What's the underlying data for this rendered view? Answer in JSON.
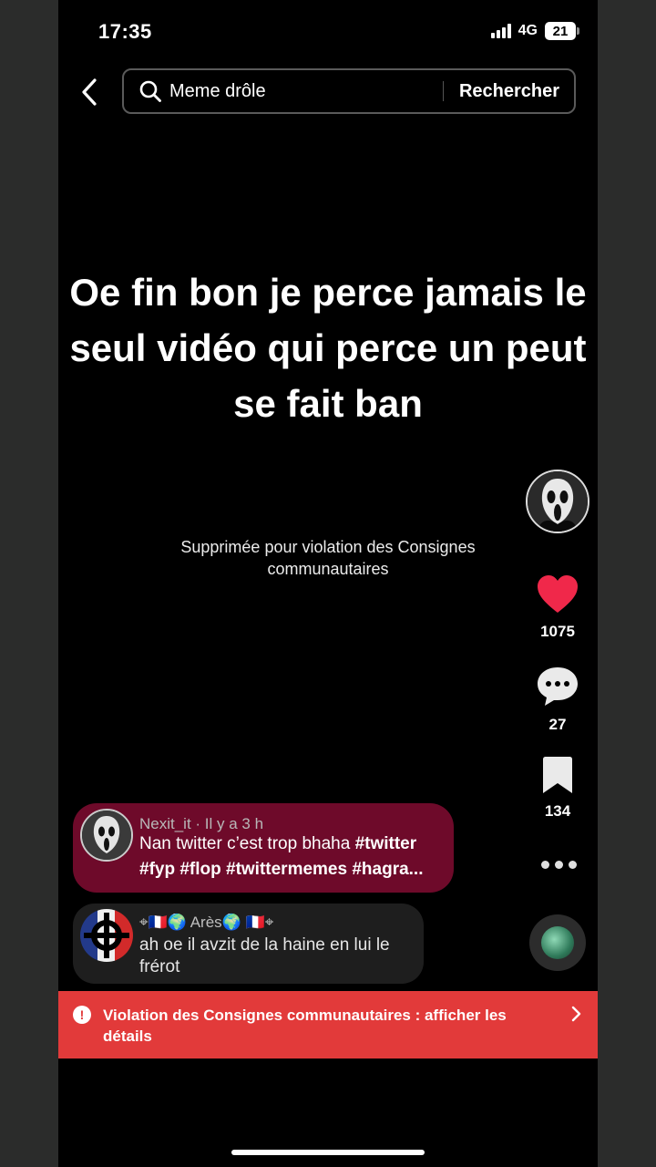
{
  "status_bar": {
    "time": "17:35",
    "network": "4G",
    "battery": "21"
  },
  "search": {
    "query": "Meme drôle",
    "button_label": "Rechercher",
    "back_icon": "chevron-left-icon",
    "search_icon": "search-icon"
  },
  "video": {
    "caption": "Oe fin bon je perce jamais le seul vidéo qui perce un peut se fait ban",
    "removed_message": "Supprimée pour violation des Consignes communautaires"
  },
  "actions": {
    "likes": "1075",
    "comments": "27",
    "saves": "134",
    "like_color": "#f0284a"
  },
  "comments": [
    {
      "author": "Nexit_it",
      "time": "Il y a 3 h",
      "text_plain": "Nan twitter c’est trop bhaha ",
      "tag_1": "#twitter",
      "tags_rest": "#fyp #flop #twittermemes #hagra..."
    },
    {
      "author": "⌖🇫🇷🌍 Arès🌍 🇫🇷⌖",
      "text": "ah oe il avzit de la haine en lui le frérot"
    }
  ],
  "violation": {
    "text": "Violation des Consignes communautaires : afficher les détails",
    "color": "#e23a3a"
  }
}
